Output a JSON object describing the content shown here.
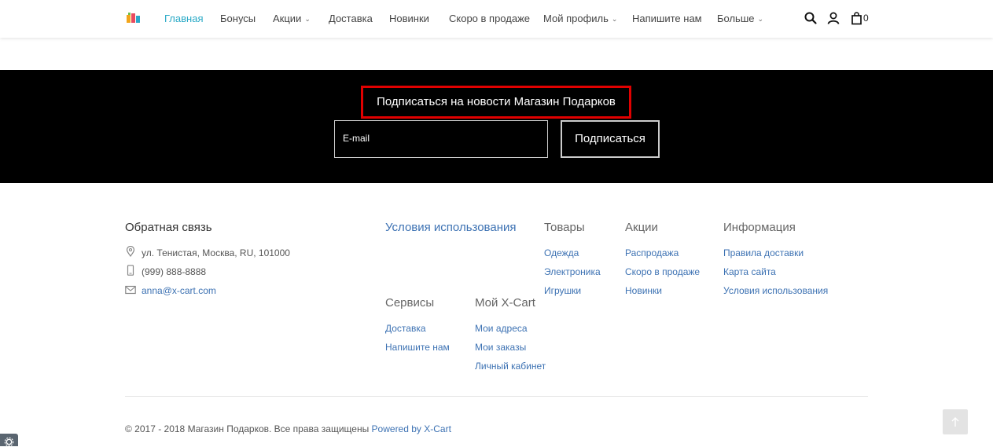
{
  "header": {
    "nav": [
      {
        "label": "Главная",
        "active": true,
        "dropdown": false
      },
      {
        "label": "Бонусы",
        "active": false,
        "dropdown": false
      },
      {
        "label": "Акции",
        "active": false,
        "dropdown": true
      },
      {
        "label": "Доставка",
        "active": false,
        "dropdown": false
      },
      {
        "label": "Новинки",
        "active": false,
        "dropdown": false
      },
      {
        "label": "Скоро в продаже",
        "active": false,
        "dropdown": false
      },
      {
        "label": "Мой профиль",
        "active": false,
        "dropdown": true
      },
      {
        "label": "Напишите нам",
        "active": false,
        "dropdown": false
      },
      {
        "label": "Больше",
        "active": false,
        "dropdown": true
      }
    ],
    "cart_count": "0",
    "icons": [
      "logo-icon",
      "search-icon",
      "user-icon",
      "shopping-bag-icon"
    ]
  },
  "subscribe": {
    "title": "Подписаться на новости Магазин Подарков",
    "email_placeholder": "E-mail",
    "button_label": "Подписаться"
  },
  "footer": {
    "contact": {
      "heading": "Обратная связь",
      "address": "ул. Тенистая, Москва, RU, 101000",
      "phone": "(999) 888-8888",
      "email": "anna@x-cart.com"
    },
    "terms_heading": "Условия использования",
    "goods": {
      "heading": "Товары",
      "links": [
        "Одежда",
        "Электроника",
        "Игрушки"
      ]
    },
    "promos": {
      "heading": "Акции",
      "links": [
        "Распродажа",
        "Скоро в продаже",
        "Новинки"
      ]
    },
    "info": {
      "heading": "Информация",
      "links": [
        "Правила доставки",
        "Карта сайта",
        "Условия использования"
      ]
    },
    "services": {
      "heading": "Сервисы",
      "links": [
        "Доставка",
        "Напишите нам"
      ]
    },
    "my_xcart": {
      "heading": "Мой X-Cart",
      "links": [
        "Мои адреса",
        "Мои заказы",
        "Личный кабинет"
      ]
    },
    "copyright": "© 2017 - 2018 Магазин Подарков. Все права защищены",
    "powered": "Powered by X-Cart"
  },
  "colors": {
    "accent": "#29a9c6",
    "link": "#3d72b3",
    "highlight": "#e00000"
  }
}
